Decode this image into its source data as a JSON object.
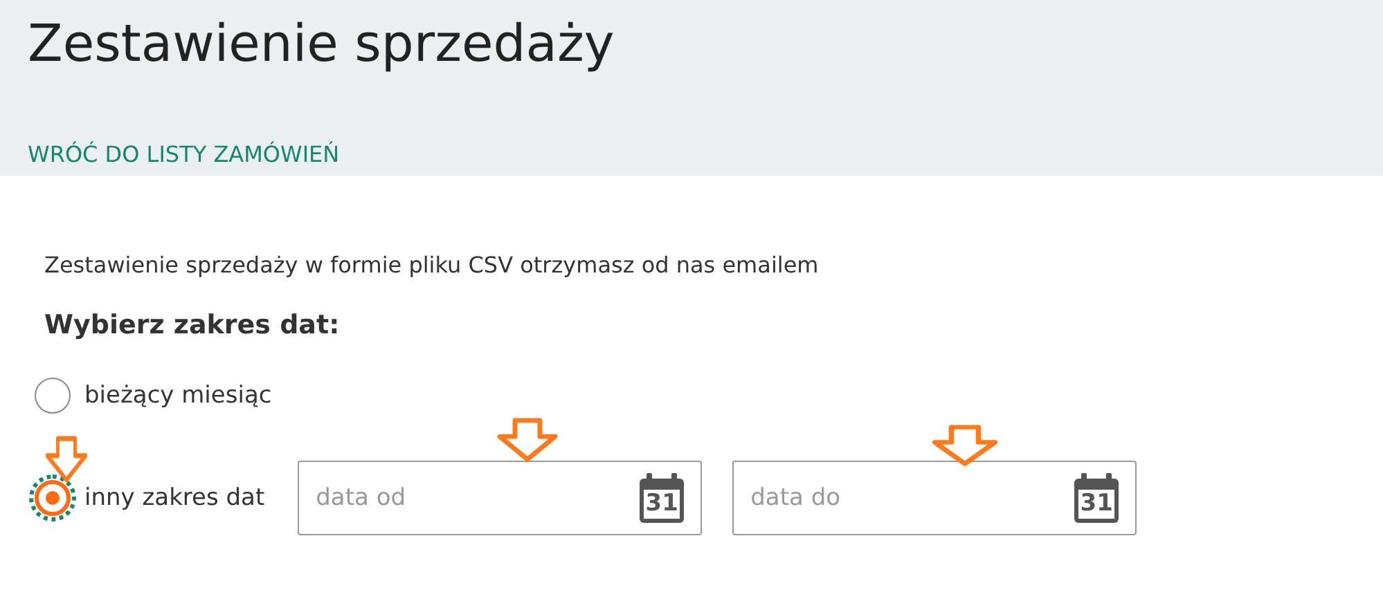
{
  "header": {
    "title": "Zestawienie sprzedaży",
    "back_link": "WRÓĆ DO LISTY ZAMÓWIEŃ"
  },
  "intro": "Zestawienie sprzedaży w formie pliku CSV otrzymasz od nas emailem",
  "range_heading": "Wybierz zakres dat:",
  "options": [
    {
      "label": "bieżący miesiąc",
      "selected": false,
      "focused": false
    },
    {
      "label": "inny zakres dat",
      "selected": true,
      "focused": true
    }
  ],
  "date_fields": [
    {
      "placeholder": "data od",
      "icon_text": "31"
    },
    {
      "placeholder": "data do",
      "icon_text": "31"
    }
  ]
}
